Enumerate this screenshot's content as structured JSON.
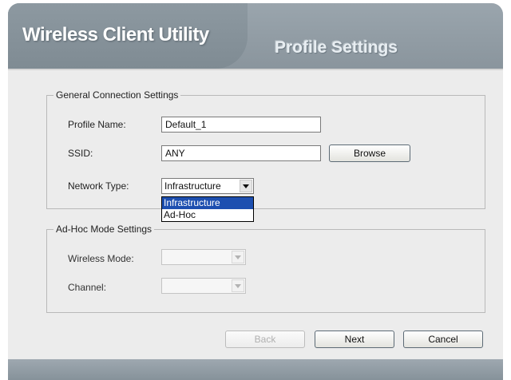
{
  "header": {
    "app_title": "Wireless Client Utility",
    "section_title": "Profile Settings"
  },
  "general": {
    "legend": "General Connection Settings",
    "profile_name_label": "Profile Name:",
    "profile_name_value": "Default_1",
    "ssid_label": "SSID:",
    "ssid_value": "ANY",
    "browse_label": "Browse",
    "network_type_label": "Network Type:",
    "network_type_value": "Infrastructure",
    "network_type_options": [
      "Infrastructure",
      "Ad-Hoc"
    ]
  },
  "adhoc": {
    "legend": "Ad-Hoc Mode Settings",
    "wireless_mode_label": "Wireless Mode:",
    "wireless_mode_value": "",
    "channel_label": "Channel:",
    "channel_value": ""
  },
  "buttons": {
    "back": "Back",
    "next": "Next",
    "cancel": "Cancel"
  },
  "colors": {
    "header": "#8d99a1",
    "selection": "#1d4fb0"
  },
  "icons": {
    "dropdown_arrow": "chevron-down-icon"
  }
}
